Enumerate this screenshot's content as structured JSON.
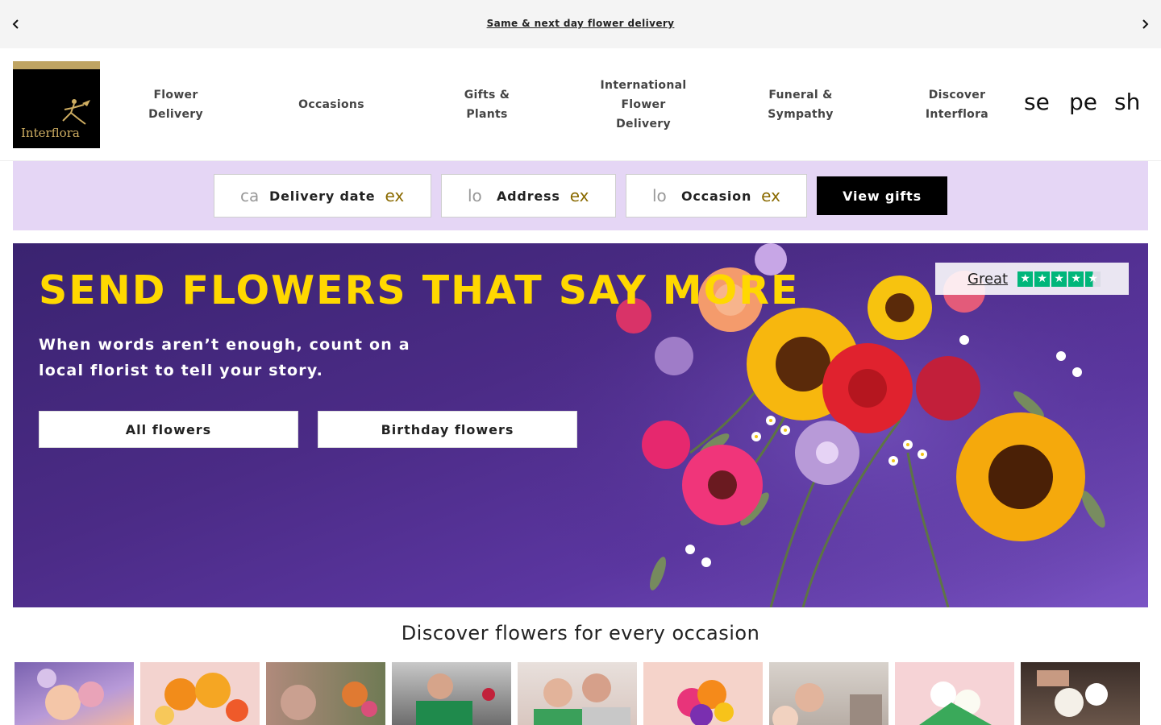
{
  "promo": {
    "text": "Same & next day flower delivery",
    "prev_icon": "chevron-left-icon",
    "next_icon": "chevron-right-icon"
  },
  "brand": {
    "name": "Interflora",
    "gold": "#bfa462"
  },
  "nav": [
    {
      "label": "Flower Delivery"
    },
    {
      "label": "Occasions"
    },
    {
      "label": "Gifts & Plants"
    },
    {
      "label": "International Flower Delivery"
    },
    {
      "label": "Funeral & Sympathy"
    },
    {
      "label": "Discover Interflora"
    }
  ],
  "header_icons": [
    {
      "text": "se",
      "icon": "search-icon"
    },
    {
      "text": "pe",
      "icon": "person-icon"
    },
    {
      "text": "sh",
      "icon": "shopping-bag-icon"
    }
  ],
  "search": {
    "background": "#e5d6f5",
    "fields": [
      {
        "icon_text": "ca",
        "icon": "calendar-icon",
        "label": "Delivery date",
        "expand_text": "ex",
        "expand_icon": "expand-icon"
      },
      {
        "icon_text": "lo",
        "icon": "location-icon",
        "label": "Address",
        "expand_text": "ex",
        "expand_icon": "expand-icon"
      },
      {
        "icon_text": "lo",
        "icon": "local-florist-icon",
        "label": "Occasion",
        "expand_text": "ex",
        "expand_icon": "expand-icon"
      }
    ],
    "submit_label": "View gifts"
  },
  "hero": {
    "title": "SEND FLOWERS THAT SAY MORE",
    "subtitle": "When words aren’t enough, count on a local florist to tell your story.",
    "buttons": [
      {
        "label": "All flowers"
      },
      {
        "label": "Birthday flowers"
      }
    ],
    "title_color": "#ffd800",
    "rating": {
      "label": "Great",
      "stars": 4.5,
      "star_color": "#00b67a"
    }
  },
  "discover": {
    "title": "Discover flowers for every occasion",
    "tile_count": 9
  }
}
